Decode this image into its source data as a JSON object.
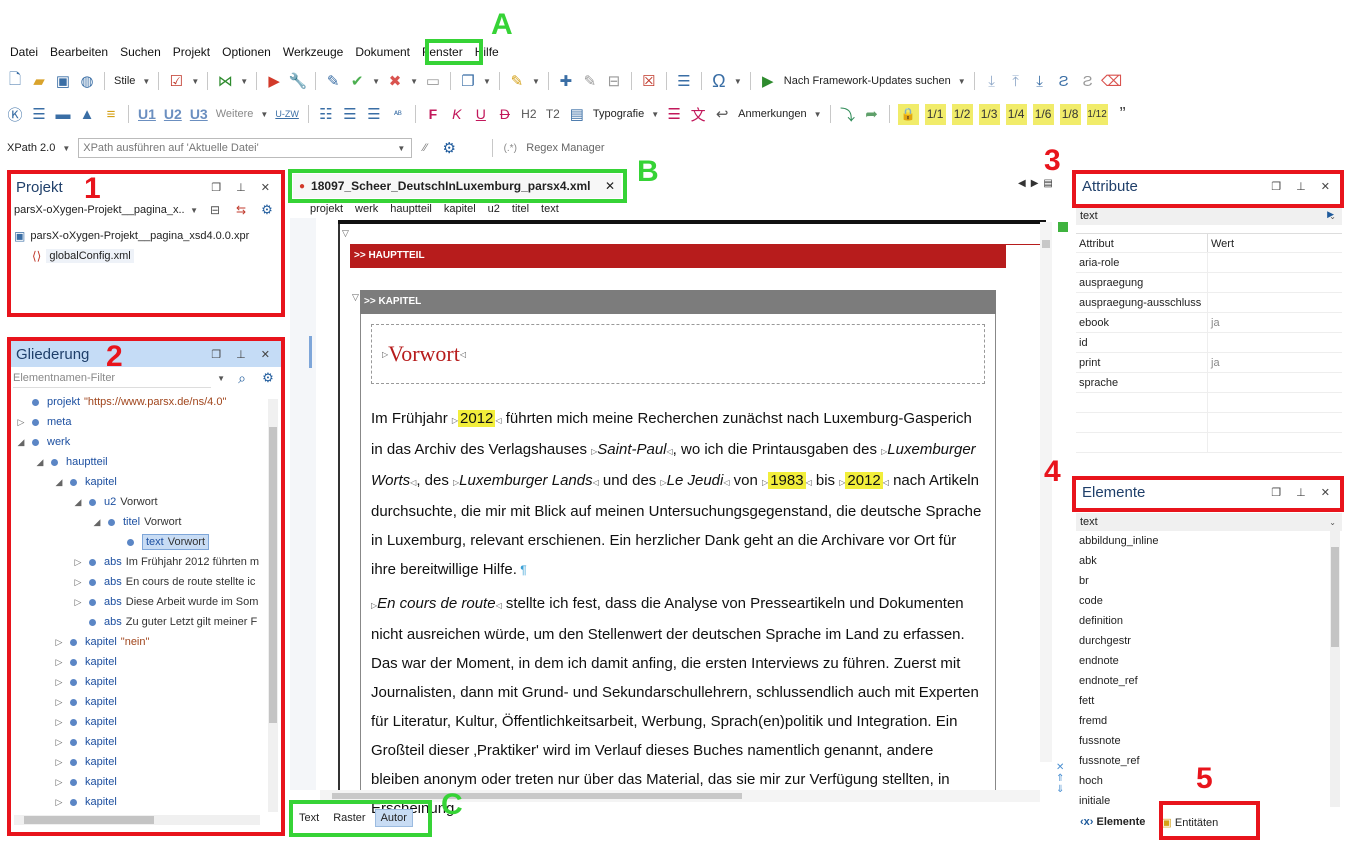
{
  "menus": [
    "Datei",
    "Bearbeiten",
    "Suchen",
    "Projekt",
    "Optionen",
    "Werkzeuge",
    "Dokument",
    "Fenster",
    "Hilfe"
  ],
  "toolbar1": {
    "stile": "Stile",
    "framework_updates": "Nach Framework-Updates suchen"
  },
  "toolbar2": {
    "u1": "U1",
    "u2": "U2",
    "u3": "U3",
    "weitere": "Weitere",
    "uzw": "U-ZW",
    "typografie": "Typografie",
    "anmerkungen": "Anmerkungen",
    "h2": "H2",
    "t2": "T2",
    "f": "F",
    "k": "K",
    "u": "U",
    "d": "D",
    "fractions": [
      "1/1",
      "1/2",
      "1/3",
      "1/4",
      "1/6",
      "1/8",
      "1/12"
    ]
  },
  "toolbar3": {
    "xpath_version": "XPath 2.0",
    "xpath_placeholder": "XPath ausführen auf 'Aktuelle Datei'",
    "regex_manager": "Regex Manager"
  },
  "project_panel": {
    "title": "Projekt",
    "selector": "parsX-oXygen-Projekt__pagina_x...",
    "root": "parsX-oXygen-Projekt__pagina_xsd4.0.0.xpr",
    "child": "globalConfig.xml"
  },
  "outline_panel": {
    "title": "Gliederung",
    "filter_placeholder": "Elementnamen-Filter",
    "items": [
      {
        "indent": 0,
        "twisty": "",
        "name": "projekt",
        "value": "\"https://www.parsx.de/ns/4.0\"",
        "is_str": true
      },
      {
        "indent": 0,
        "twisty": "▷",
        "name": "meta",
        "value": ""
      },
      {
        "indent": 0,
        "twisty": "◢",
        "name": "werk",
        "value": ""
      },
      {
        "indent": 1,
        "twisty": "◢",
        "name": "hauptteil",
        "value": ""
      },
      {
        "indent": 2,
        "twisty": "◢",
        "name": "kapitel",
        "value": ""
      },
      {
        "indent": 3,
        "twisty": "◢",
        "name": "u2",
        "value": "Vorwort"
      },
      {
        "indent": 4,
        "twisty": "◢",
        "name": "titel",
        "value": "Vorwort"
      },
      {
        "indent": 5,
        "twisty": "",
        "name": "text",
        "value": "Vorwort",
        "selected": true
      },
      {
        "indent": 3,
        "twisty": "▷",
        "name": "abs",
        "value": "Im Frühjahr 2012 führten m"
      },
      {
        "indent": 3,
        "twisty": "▷",
        "name": "abs",
        "value": "En cours de route stellte ic"
      },
      {
        "indent": 3,
        "twisty": "▷",
        "name": "abs",
        "value": "Diese Arbeit wurde im Som"
      },
      {
        "indent": 3,
        "twisty": "",
        "name": "abs",
        "value": "Zu guter Letzt gilt meiner F"
      },
      {
        "indent": 2,
        "twisty": "▷",
        "name": "kapitel",
        "value": "\"nein\"",
        "is_str": true
      },
      {
        "indent": 2,
        "twisty": "▷",
        "name": "kapitel",
        "value": ""
      },
      {
        "indent": 2,
        "twisty": "▷",
        "name": "kapitel",
        "value": ""
      },
      {
        "indent": 2,
        "twisty": "▷",
        "name": "kapitel",
        "value": ""
      },
      {
        "indent": 2,
        "twisty": "▷",
        "name": "kapitel",
        "value": ""
      },
      {
        "indent": 2,
        "twisty": "▷",
        "name": "kapitel",
        "value": ""
      },
      {
        "indent": 2,
        "twisty": "▷",
        "name": "kapitel",
        "value": ""
      },
      {
        "indent": 2,
        "twisty": "▷",
        "name": "kapitel",
        "value": ""
      },
      {
        "indent": 2,
        "twisty": "▷",
        "name": "kapitel",
        "value": ""
      }
    ]
  },
  "editor": {
    "tab_title": "18097_Scheer_DeutschInLuxemburg_parsx4.xml",
    "breadcrumb": [
      "projekt",
      "werk",
      "hauptteil",
      "kapitel",
      "u2",
      "titel",
      "text"
    ],
    "hauptteil_label": ">> HAUPTTEIL",
    "kapitel_label": ">> KAPITEL",
    "heading": "Vorwort",
    "p1": {
      "a": "Im Frühjahr ",
      "y1": "2012",
      "b": " führten mich meine Recherchen zunächst nach Luxemburg-Gasperich in das Archiv des Verlagshauses ",
      "i1": "Saint-Paul",
      "c": ", wo ich die Printausgaben des ",
      "i2": "Luxemburger Worts",
      "d": ", des ",
      "i3": "Luxemburger Lands",
      "e": " und des ",
      "i4": "Le Jeudi",
      "f": " von ",
      "y2": "1983",
      "g": " bis ",
      "y3": "2012",
      "h": " nach Artikeln durchsuchte, die mir mit Blick auf meinen Untersuchungsgegenstand, die deutsche Sprache in Luxemburg, relevant erschienen. Ein herzlicher Dank geht an die Archivare vor Ort für ihre bereitwillige Hilfe."
    },
    "p2": {
      "i1": "En cours de route",
      "a": " stellte ich fest, dass die Analyse von Presseartikeln und Dokumenten nicht ausreichen würde, um den Stellenwert der deutschen Sprache im Land zu erfassen. Das war der Moment, in dem ich damit anfing, die ersten Interviews zu führen. Zuerst mit Journalisten, dann mit Grund- und Sekundarschullehrern, schlussendlich auch mit Experten für Literatur, Kultur, Öffentlichkeitsarbeit, Werbung, Sprach(en)politik und Integration. Ein Großteil dieser ‚Praktiker' wird im Verlauf dieses Buches namentlich genannt, andere bleiben anonym oder treten nur über das Material, das sie mir zur Verfügung stellten, in Erscheinung."
    },
    "modes": [
      "Text",
      "Raster",
      "Autor"
    ],
    "active_mode": "Autor"
  },
  "attribute_panel": {
    "title": "Attribute",
    "element": "text",
    "col_attr": "Attribut",
    "col_value": "Wert",
    "rows": [
      [
        "aria-role",
        ""
      ],
      [
        "auspraegung",
        ""
      ],
      [
        "auspraegung-ausschluss",
        ""
      ],
      [
        "ebook",
        "ja"
      ],
      [
        "id",
        ""
      ],
      [
        "print",
        "ja"
      ],
      [
        "sprache",
        ""
      ]
    ]
  },
  "elements_panel": {
    "title": "Elemente",
    "element": "text",
    "items": [
      "abbildung_inline",
      "abk",
      "br",
      "code",
      "definition",
      "durchgestr",
      "endnote",
      "endnote_ref",
      "fett",
      "fremd",
      "fussnote",
      "fussnote_ref",
      "hoch",
      "initiale"
    ],
    "tab_elements": "Elemente",
    "tab_entities": "Entitäten"
  },
  "callouts": {
    "A": "A",
    "B": "B",
    "C": "C",
    "n1": "1",
    "n2": "2",
    "n3": "3",
    "n4": "4",
    "n5": "5"
  }
}
